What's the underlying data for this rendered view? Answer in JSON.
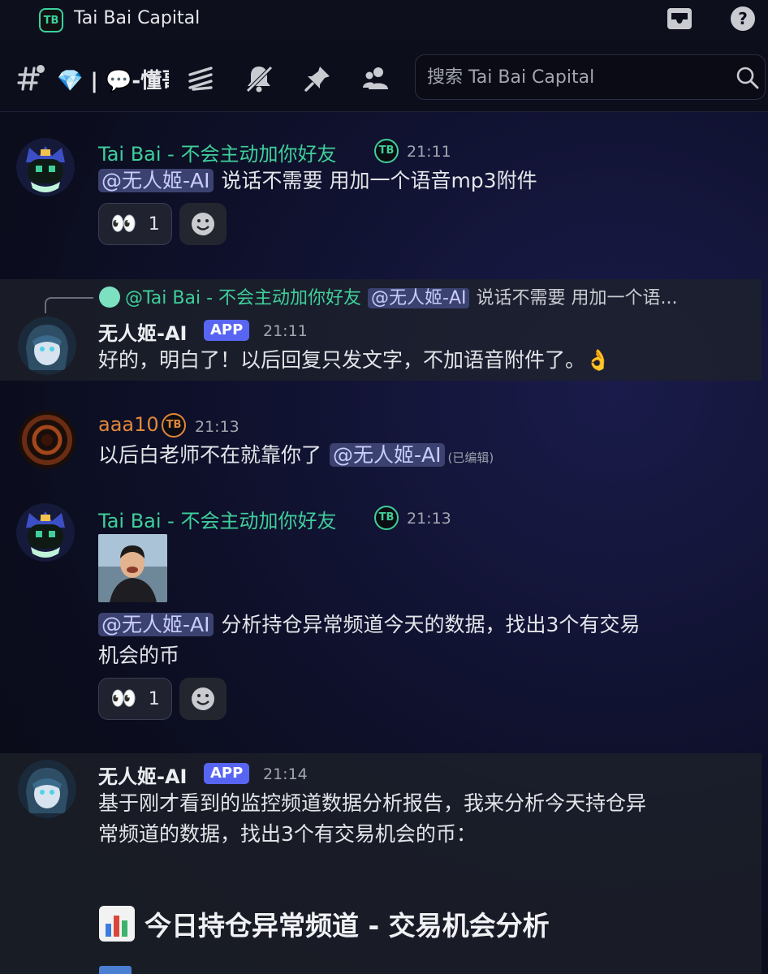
{
  "window": {
    "title": "Tai Bai Capital",
    "logo_text": "TB"
  },
  "toolbar": {
    "channel_name": "💎 | 💬-懂哥",
    "search_placeholder": "搜索 Tai Bai Capital"
  },
  "colors": {
    "taibai_name": "#3fcf9a",
    "aaa_name": "#e2873a",
    "app_badge": "#5865f2",
    "mention_bg": "#3c4270"
  },
  "messages": [
    {
      "author": "Tai Bai - 不会主动加你好友",
      "badge": "TB",
      "time": "21:11",
      "mention": "@无人姬-AI",
      "text": "说话不需要 用加一个语音mp3附件",
      "reaction": {
        "emoji": "👀",
        "count": "1"
      }
    },
    {
      "reply": {
        "author": "@Tai Bai - 不会主动加你好友",
        "mention": "@无人姬-AI",
        "text": "说话不需要 用加一个语..."
      },
      "author": "无人姬-AI",
      "tag": "APP",
      "time": "21:11",
      "text": "好的，明白了！以后回复只发文字，不加语音附件了。👌"
    },
    {
      "author": "aaa10",
      "badge": "TB",
      "time": "21:13",
      "text": "以后白老师不在就靠你了",
      "mention": "@无人姬-AI",
      "edited": "(已编辑)"
    },
    {
      "author": "Tai Bai - 不会主动加你好友",
      "badge": "TB",
      "time": "21:13",
      "mention": "@无人姬-AI",
      "text_line1": "分析持仓异常频道今天的数据，找出3个有交易",
      "text_line2": "机会的币",
      "reaction": {
        "emoji": "👀",
        "count": "1"
      }
    },
    {
      "author": "无人姬-AI",
      "tag": "APP",
      "time": "21:14",
      "text_line1": "基于刚才看到的监控频道数据分析报告，我来分析今天持仓异",
      "text_line2": "常频道的数据，找出3个有交易机会的币：",
      "heading": "今日持仓异常频道 - 交易机会分析"
    }
  ]
}
